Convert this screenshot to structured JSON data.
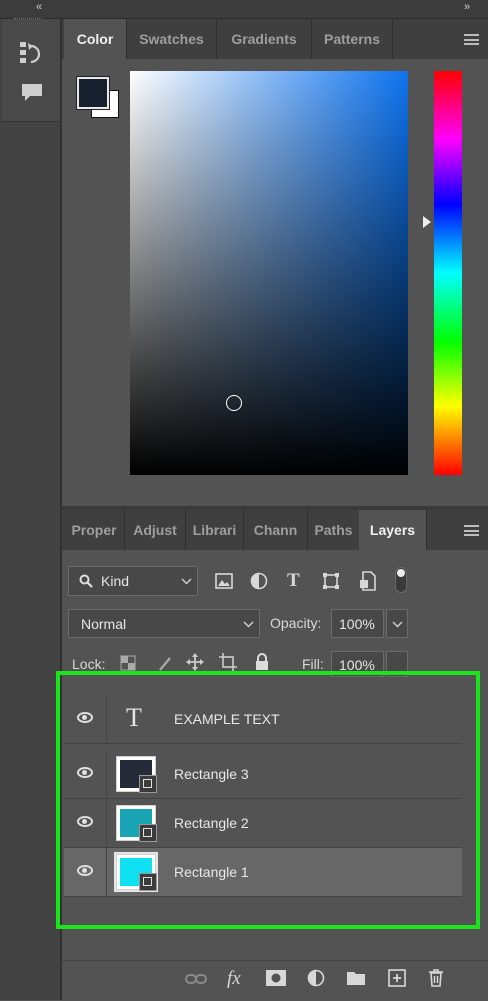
{
  "header": {
    "collapse_left": "«",
    "collapse_right": "»"
  },
  "dock": {
    "icons": [
      "history-icon",
      "comment-icon"
    ]
  },
  "color_panel": {
    "tabs": [
      "Color",
      "Swatches",
      "Gradients",
      "Patterns"
    ],
    "active_tab": "Color",
    "foreground_color": "#16202e",
    "background_color": "#ffffff",
    "field_hue_color": "#0d73f0"
  },
  "layers_panel": {
    "tabs": [
      "Proper",
      "Adjust",
      "Librari",
      "Chann",
      "Paths",
      "Layers"
    ],
    "active_tab": "Layers",
    "filter": {
      "kind_label": "Kind"
    },
    "blend_mode": "Normal",
    "opacity_label": "Opacity:",
    "opacity_value": "100%",
    "lock_label": "Lock:",
    "fill_label": "Fill:",
    "fill_value": "100%",
    "text_glyph": "T",
    "layers": [
      {
        "name": "EXAMPLE TEXT",
        "type": "text",
        "thumb_glyph": "T"
      },
      {
        "name": "Rectangle 3",
        "type": "shape",
        "color": "#232b38"
      },
      {
        "name": "Rectangle 2",
        "type": "shape",
        "color": "#1aa5b4"
      },
      {
        "name": "Rectangle 1",
        "type": "shape",
        "color": "#0fe0f0",
        "selected": true
      }
    ],
    "footer_icons": [
      "link-icon",
      "fx-icon",
      "mask-icon",
      "adjustment-icon",
      "group-folder-icon",
      "new-layer-icon",
      "trash-icon"
    ],
    "fx_label": "fx"
  },
  "highlight_color": "#19e619"
}
